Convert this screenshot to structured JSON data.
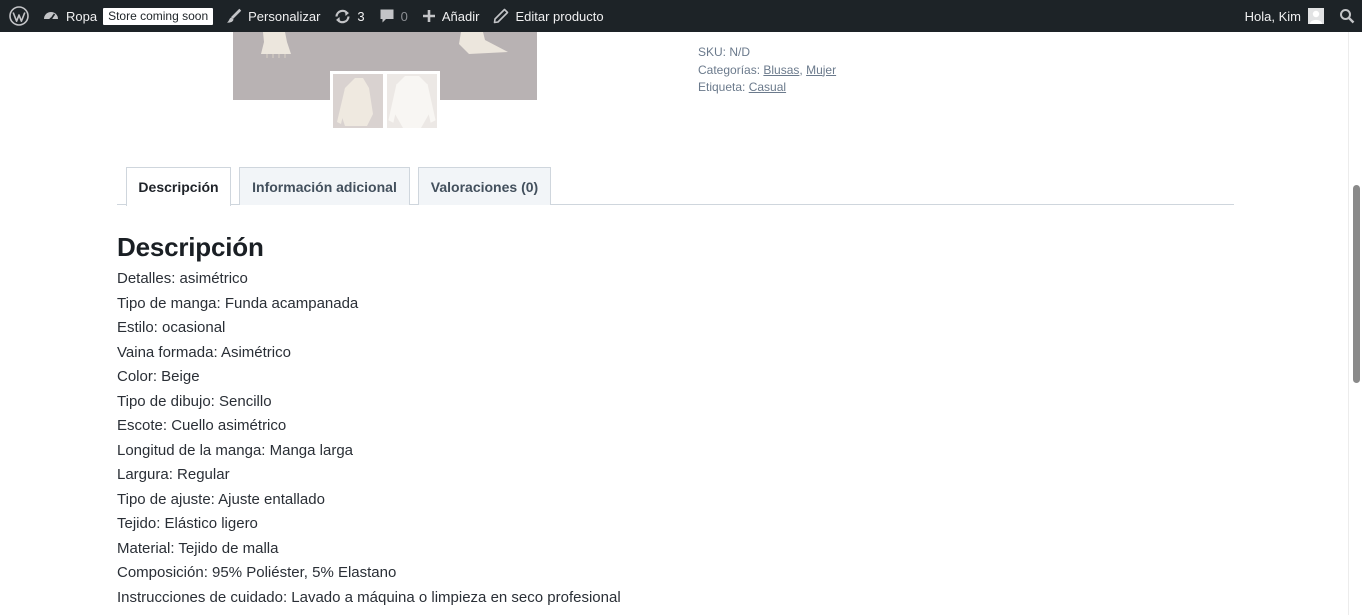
{
  "admin_bar": {
    "site_name": "Ropa",
    "store_badge": "Store coming soon",
    "customize": "Personalizar",
    "updates_count": "3",
    "comments_count": "0",
    "new_label": "Añadir",
    "edit_label": "Editar producto",
    "howdy": "Hola, Kim",
    "icons": [
      "wordpress-logo-icon",
      "dashboard-icon",
      "brush-icon",
      "updates-icon",
      "comment-icon",
      "plus-icon",
      "pencil-icon",
      "search-icon"
    ]
  },
  "product_meta": {
    "sku_label": "SKU:",
    "sku_value": "N/D",
    "categories_label": "Categorías:",
    "categories": [
      "Blusas",
      "Mujer"
    ],
    "tag_label": "Etiqueta:",
    "tag": "Casual"
  },
  "tabs": [
    {
      "label": "Descripción",
      "active": true
    },
    {
      "label": "Información adicional",
      "active": false
    },
    {
      "label": "Valoraciones (0)",
      "active": false
    }
  ],
  "description": {
    "title": "Descripción",
    "lines": [
      "Detalles: asimétrico",
      "Tipo de manga: Funda acampanada",
      "Estilo: ocasional",
      "Vaina formada: Asimétrico",
      "Color: Beige",
      "Tipo de dibujo: Sencillo",
      "Escote: Cuello asimétrico",
      "Longitud de la manga: Manga larga",
      "Largura: Regular",
      "Tipo de ajuste: Ajuste entallado",
      "Tejido: Elástico ligero",
      "Material: Tejido de malla",
      "Composición: 95% Poliéster, 5% Elastano",
      "Instrucciones de cuidado: Lavado a máquina o limpieza en seco profesional"
    ]
  },
  "colors": {
    "admin_bar_bg": "#1d2327",
    "admin_bar_text": "#f0f0f1",
    "meta_text": "#6b7a8c",
    "tab_border": "#cfd6dd",
    "body_text": "#2a2f36"
  }
}
